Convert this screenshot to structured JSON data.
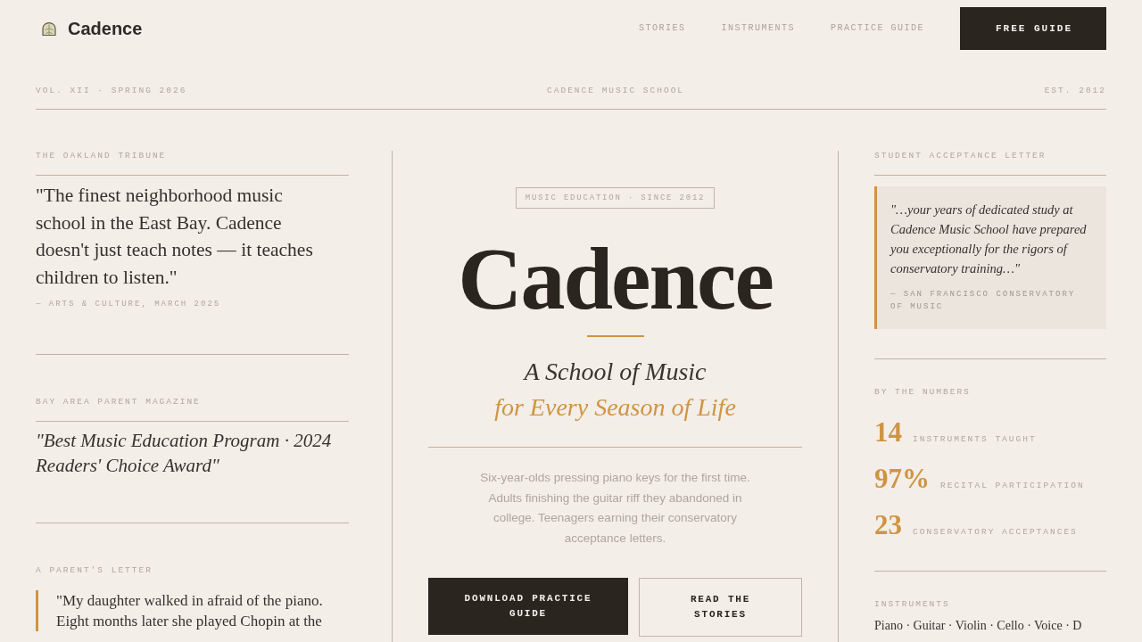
{
  "header": {
    "brand": "Cadence",
    "nav": [
      "STORIES",
      "INSTRUMENTS",
      "PRACTICE GUIDE"
    ],
    "cta": "FREE GUIDE"
  },
  "masthead": {
    "volume": "VOL. XII · SPRING 2026",
    "school": "CADENCE MUSIC SCHOOL",
    "established": "EST. 2012"
  },
  "press": [
    {
      "kind": "quote",
      "source": "THE OAKLAND TRIBUNE",
      "quote": "\"The finest neighborhood music school in the East Bay. Cadence doesn't just teach notes — it teaches children to listen.\"",
      "attribution": "— ARTS & CULTURE, MARCH 2025"
    },
    {
      "kind": "award",
      "source": "BAY AREA PARENT MAGAZINE",
      "quote": "\"Best Music Education Program · 2024 Readers' Choice Award\""
    },
    {
      "kind": "letter",
      "source": "A PARENT'S LETTER",
      "quote": "\"My daughter walked in afraid of the piano. Eight months later she played Chopin at the"
    }
  ],
  "hero": {
    "badge": "MUSIC EDUCATION · SINCE 2012",
    "title": "Cadence",
    "tagline": "A School of Music",
    "tagline_accent": "for Every Season of Life",
    "intro": "Six-year-olds pressing piano keys for the first time. Adults finishing the guitar riff they abandoned in college. Teenagers earning their conservatory acceptance letters.",
    "buttons": [
      {
        "kind": "primary",
        "label": "DOWNLOAD PRACTICE GUIDE"
      },
      {
        "kind": "secondary",
        "label": "READ THE STORIES"
      }
    ]
  },
  "sidebar": {
    "letter": {
      "label": "STUDENT ACCEPTANCE LETTER",
      "quote": "\"…your years of dedicated study at Cadence Music School have prepared you exceptionally for the rigors of conservatory training…\"",
      "attribution": "— SAN FRANCISCO CONSERVATORY OF MUSIC"
    },
    "numbers": {
      "label": "BY THE NUMBERS",
      "stats": [
        {
          "value": "14",
          "label": "INSTRUMENTS TAUGHT"
        },
        {
          "value": "97%",
          "label": "RECITAL PARTICIPATION"
        },
        {
          "value": "23",
          "label": "CONSERVATORY ACCEPTANCES"
        }
      ]
    },
    "instruments": {
      "label": "INSTRUMENTS",
      "list": "Piano · Guitar · Violin · Cello · Voice · D"
    }
  }
}
